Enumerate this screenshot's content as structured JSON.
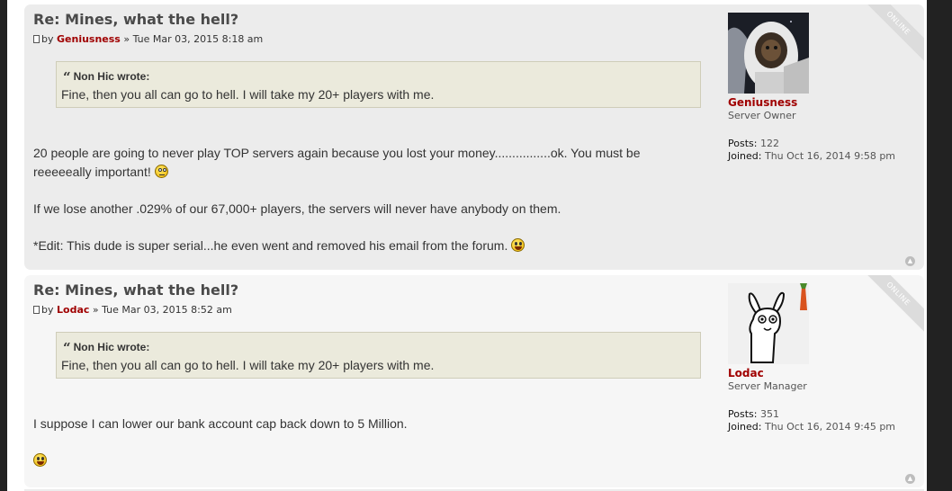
{
  "posts": [
    {
      "title": "Re: Mines, what the hell?",
      "by": "by",
      "author": "Geniusness",
      "sep": "»",
      "date": "Tue Mar 03, 2015 8:18 am",
      "quote": {
        "cite": "Non Hic wrote:",
        "text": "Fine, then you all can go to hell. I will take my 20+ players with me."
      },
      "paragraphs": [
        "20 people are going to never play TOP servers again because you lost your money................ok. You must be reeeeeally important!",
        "If we lose another .029% of our 67,000+ players, the servers will never have anybody on them.",
        "*Edit: This dude is super serial...he even went and removed his email from the forum."
      ],
      "profile": {
        "status": "ONLINE",
        "name": "Geniusness",
        "rank": "Server Owner",
        "posts_label": "Posts:",
        "posts": "122",
        "joined_label": "Joined:",
        "joined": "Thu Oct 16, 2014 9:58 pm"
      }
    },
    {
      "title": "Re: Mines, what the hell?",
      "by": "by",
      "author": "Lodac",
      "sep": "»",
      "date": "Tue Mar 03, 2015 8:52 am",
      "quote": {
        "cite": "Non Hic wrote:",
        "text": "Fine, then you all can go to hell. I will take my 20+ players with me."
      },
      "paragraphs": [
        "I suppose I can lower our bank account cap back down to 5 Million."
      ],
      "profile": {
        "status": "ONLINE",
        "name": "Lodac",
        "rank": "Server Manager",
        "posts_label": "Posts:",
        "posts": "351",
        "joined_label": "Joined:",
        "joined": "Thu Oct 16, 2014 9:45 pm"
      }
    }
  ],
  "icons": {
    "post_icon": "file-icon",
    "quote_icon": "quote-icon",
    "top_icon": "top-arrow-icon",
    "smileys": [
      "rolleyes-icon",
      "laughing-icon"
    ]
  },
  "colors": {
    "author": "#a00000",
    "post_bg_1": "#ececec",
    "post_bg_2": "#f6f6f6",
    "quote_bg": "#ebeadc"
  }
}
